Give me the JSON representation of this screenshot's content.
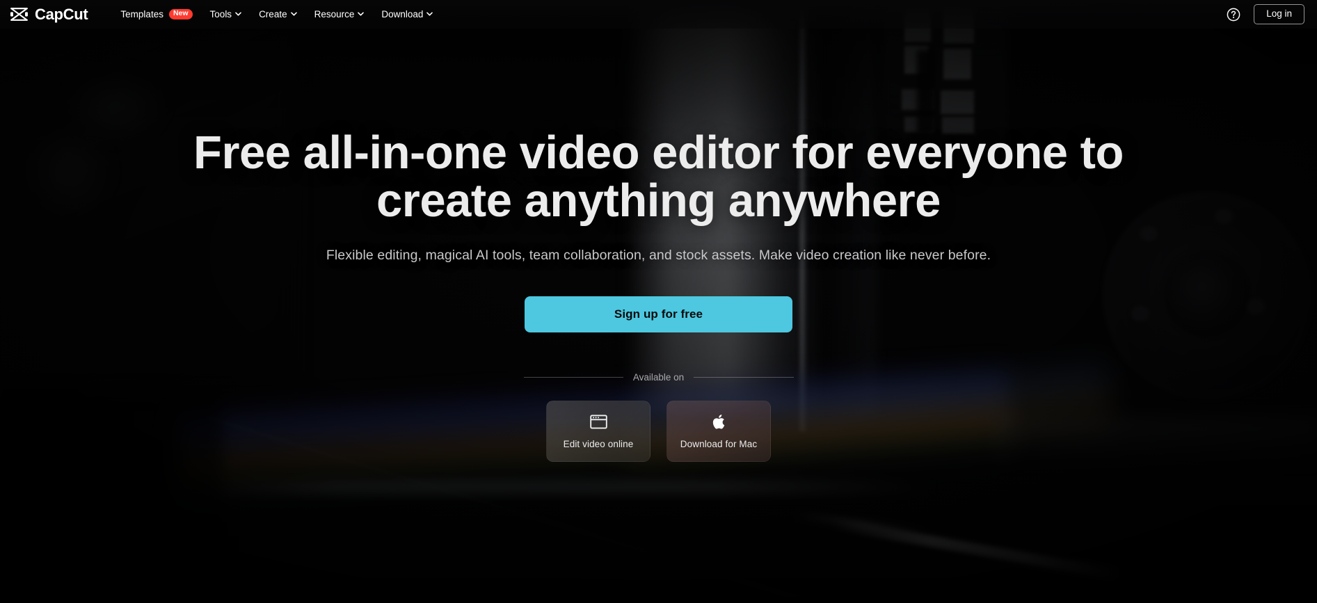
{
  "brand": {
    "name": "CapCut",
    "logo_icon": "capcut-bowtie-logo-icon"
  },
  "header": {
    "nav": [
      {
        "label": "Templates",
        "badge": "New",
        "has_chevron": false
      },
      {
        "label": "Tools",
        "badge": null,
        "has_chevron": true
      },
      {
        "label": "Create",
        "badge": null,
        "has_chevron": true
      },
      {
        "label": "Resource",
        "badge": null,
        "has_chevron": true
      },
      {
        "label": "Download",
        "badge": null,
        "has_chevron": true
      }
    ],
    "help_icon": "question-mark-circle-icon",
    "login_label": "Log in"
  },
  "hero": {
    "title_line1": "Free all-in-one video editor for everyone to",
    "title_line2": "create anything anywhere",
    "subtitle": "Flexible editing, magical AI tools, team collaboration, and stock assets. Make video creation like never before.",
    "cta_label": "Sign up for free",
    "available_on_label": "Available on",
    "cards": [
      {
        "label": "Edit video online",
        "icon": "browser-window-icon"
      },
      {
        "label": "Download for Mac",
        "icon": "apple-logo-icon"
      }
    ]
  },
  "colors": {
    "page_background": "#000000",
    "cta_background": "#4DC8E0",
    "cta_text": "#0A0A0A",
    "badge_background": "#FF3B30",
    "heading_text": "#ECECEC",
    "subtitle_text": "#C9C9CB",
    "nav_text": "#FFFFFF"
  }
}
